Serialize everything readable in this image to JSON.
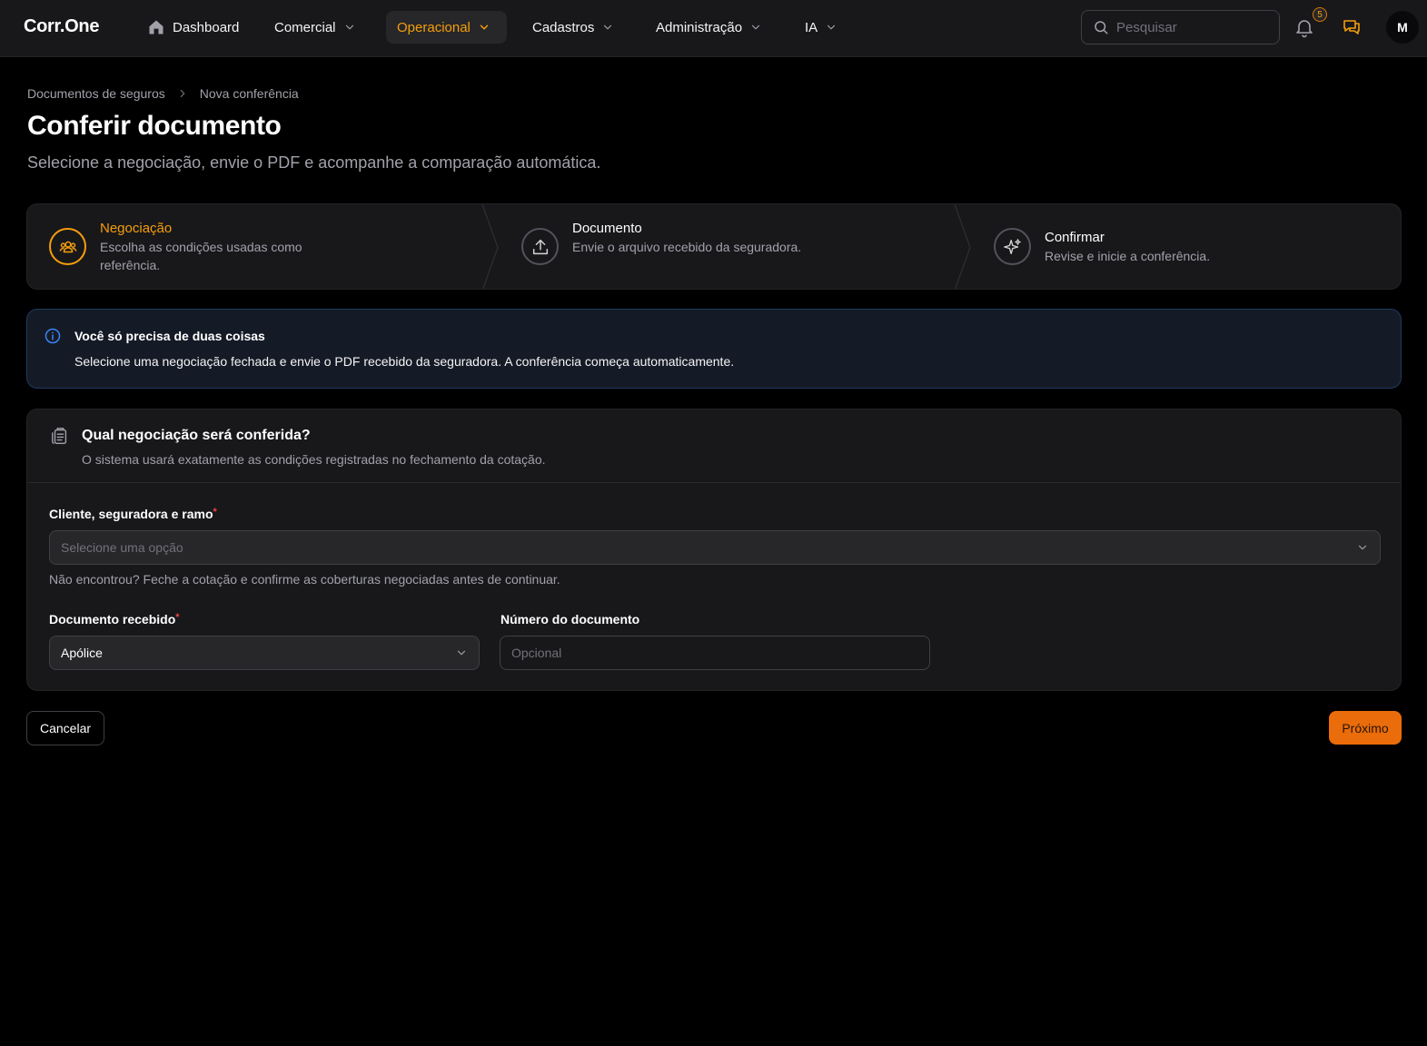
{
  "app": {
    "brand": "Corr.One"
  },
  "nav": {
    "items": [
      {
        "label": "Dashboard",
        "icon": "home-icon"
      },
      {
        "label": "Comercial",
        "icon": "chevron-down-icon"
      },
      {
        "label": "Operacional",
        "icon": "chevron-down-icon",
        "active": true
      },
      {
        "label": "Cadastros",
        "icon": "chevron-down-icon"
      },
      {
        "label": "Administração",
        "icon": "chevron-down-icon"
      },
      {
        "label": "IA",
        "icon": "chevron-down-icon"
      }
    ],
    "search_placeholder": "Pesquisar",
    "notifications_count": "5",
    "avatar_initial": "M"
  },
  "breadcrumb": {
    "parent": "Documentos de seguros",
    "current": "Nova conferência"
  },
  "header": {
    "title": "Conferir documento",
    "subtitle": "Selecione a negociação, envie o PDF e acompanhe a comparação automática."
  },
  "stepper": {
    "steps": [
      {
        "title": "Negociação",
        "description": "Escolha as condições usadas como referência.",
        "icon": "users-icon",
        "active": true
      },
      {
        "title": "Documento",
        "description": "Envie o arquivo recebido da seguradora.",
        "icon": "upload-icon",
        "active": false
      },
      {
        "title": "Confirmar",
        "description": "Revise e inicie a conferência.",
        "icon": "sparkles-icon",
        "active": false
      }
    ]
  },
  "info": {
    "title": "Você só precisa de duas coisas",
    "text": "Selecione uma negociação fechada e envie o PDF recebido da seguradora. A conferência começa automaticamente."
  },
  "form": {
    "title": "Qual negociação será conferida?",
    "description": "O sistema usará exatamente as condições registradas no fechamento da cotação.",
    "negotiation_label": "Cliente, seguradora e ramo",
    "negotiation_placeholder": "Selecione uma opção",
    "negotiation_hint": "Não encontrou? Feche a cotação e confirme as coberturas negociadas antes de continuar.",
    "doc_type_label": "Documento recebido",
    "doc_type_value": "Apólice",
    "doc_number_label": "Número do documento",
    "doc_number_placeholder": "Opcional",
    "required_mark": "*"
  },
  "actions": {
    "cancel": "Cancelar",
    "next": "Próximo"
  },
  "colors": {
    "accent": "#f59e0b",
    "primary_button": "#ea6c0a",
    "info_border": "#1e3a5f"
  }
}
